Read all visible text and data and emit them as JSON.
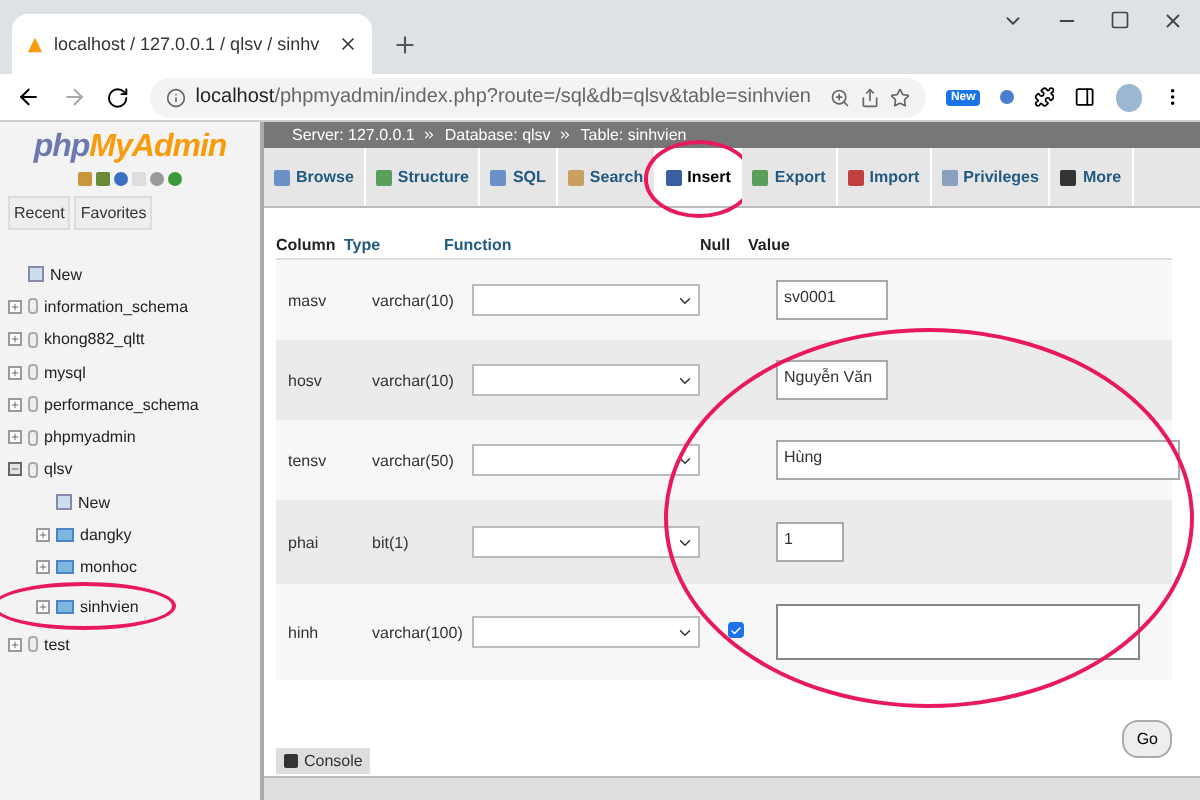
{
  "browser": {
    "tab_title": "localhost / 127.0.0.1 / qlsv / sinhv",
    "url_host": "localhost",
    "url_path": "/phpmyadmin/index.php?route=/sql&db=qlsv&table=sinhvien",
    "extension_badge": "New"
  },
  "sidebar": {
    "logo_php": "php",
    "logo_rest": "MyAdmin",
    "tabs": [
      {
        "label": "Recent",
        "selected": false
      },
      {
        "label": "Favorites",
        "selected": false
      }
    ],
    "tree": [
      {
        "label": "New",
        "kind": "new"
      },
      {
        "label": "information_schema",
        "kind": "db",
        "expanded": false
      },
      {
        "label": "khong882_qltt",
        "kind": "db",
        "expanded": false
      },
      {
        "label": "mysql",
        "kind": "db",
        "expanded": false
      },
      {
        "label": "performance_schema",
        "kind": "db",
        "expanded": false
      },
      {
        "label": "phpmyadmin",
        "kind": "db",
        "expanded": false
      },
      {
        "label": "qlsv",
        "kind": "db",
        "expanded": true,
        "children": [
          {
            "label": "New",
            "kind": "new"
          },
          {
            "label": "dangky",
            "kind": "table",
            "expanded": false
          },
          {
            "label": "monhoc",
            "kind": "table",
            "expanded": false
          },
          {
            "label": "sinhvien",
            "kind": "table",
            "expanded": false,
            "circled": true
          }
        ]
      },
      {
        "label": "test",
        "kind": "db",
        "expanded": false
      }
    ]
  },
  "breadcrumb": [
    "Server: 127.0.0.1",
    "Database: qlsv",
    "Table: sinhvien"
  ],
  "tabs": [
    {
      "label": "Browse",
      "selected": false
    },
    {
      "label": "Structure",
      "selected": false
    },
    {
      "label": "SQL",
      "selected": false
    },
    {
      "label": "Search",
      "selected": false
    },
    {
      "label": "Insert",
      "selected": true,
      "circled": true
    },
    {
      "label": "Export",
      "selected": false
    },
    {
      "label": "Import",
      "selected": false
    },
    {
      "label": "Privileges",
      "selected": false
    },
    {
      "label": "More",
      "selected": false
    }
  ],
  "form": {
    "headers": [
      "Column",
      "Type",
      "Function",
      "Null",
      "Value"
    ],
    "values_circled": true,
    "rows": [
      {
        "column": "masv",
        "type": "varchar(10)",
        "kind": "short",
        "value": "sv0001"
      },
      {
        "column": "hosv",
        "type": "varchar(10)",
        "kind": "short",
        "value": "Nguyễn Văn"
      },
      {
        "column": "tensv",
        "type": "varchar(50)",
        "kind": "long",
        "value": "Hùng"
      },
      {
        "column": "phai",
        "type": "bit(1)",
        "kind": "tiny",
        "value": "1"
      },
      {
        "column": "hinh",
        "type": "varchar(100)",
        "kind": "textarea",
        "null_checked": true
      }
    ],
    "go_button": "Go"
  },
  "console": "Console"
}
